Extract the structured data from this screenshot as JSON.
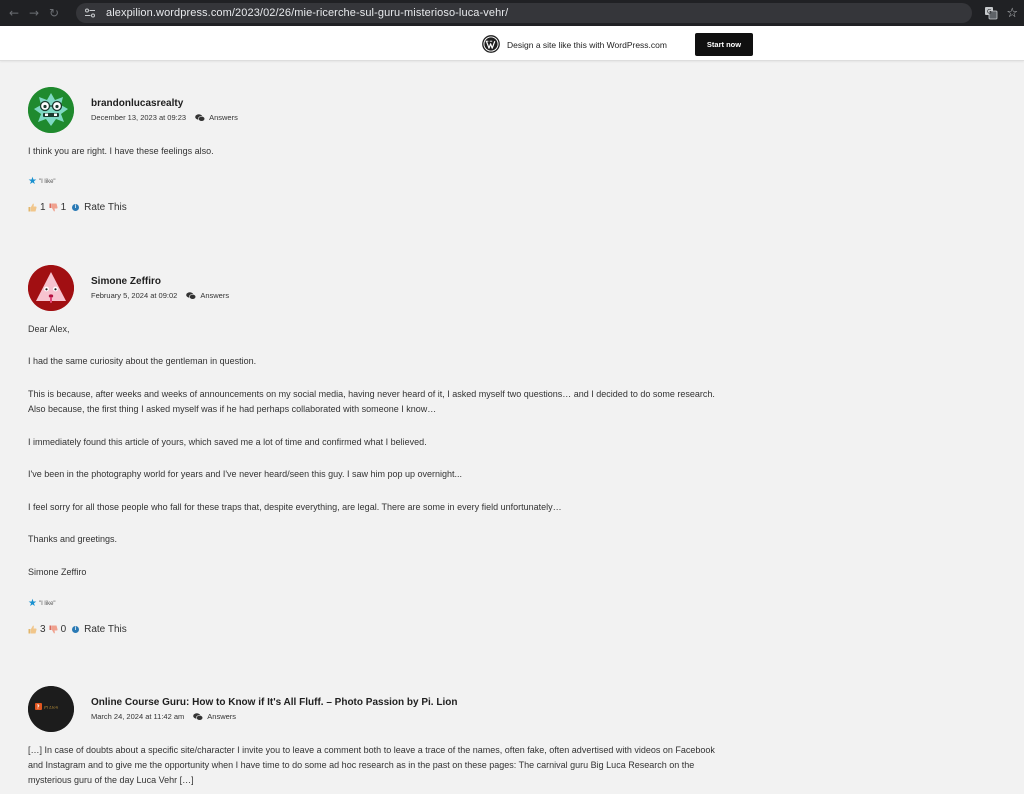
{
  "browser": {
    "url": "alexpilion.wordpress.com/2023/02/26/mie-ricerche-sul-guru-misterioso-luca-vehr/",
    "back_icon": "←",
    "forward_icon": "→",
    "reload_icon": "↻",
    "star_icon": "☆"
  },
  "wp_banner": {
    "text": "Design a site like this with WordPress.com",
    "button_label": "Start now"
  },
  "comments": [
    {
      "author": "brandonlucasrealty",
      "date": "December 13, 2023 at 09:23",
      "reply_label": "Answers",
      "paragraphs": [
        "I think you are right. I have these feelings also."
      ],
      "like_label": "\"I like\"",
      "thumbs_up": "1",
      "thumbs_down": "1",
      "rate_label": "Rate This",
      "avatar_color": "#1f8a2e"
    },
    {
      "author": "Simone Zeffiro",
      "date": "February 5, 2024 at 09:02",
      "reply_label": "Answers",
      "paragraphs": [
        "Dear Alex,",
        "I had the same curiosity about the gentleman in question.",
        "This is because, after weeks and weeks of announcements on my social media, having never heard of it, I asked myself two questions… and I decided to do some research. Also because, the first thing I asked myself was if he had perhaps collaborated with someone I know…",
        "I immediately found this article of yours, which saved me a lot of time and confirmed what I believed.",
        "I've been in the photography world for years and I've never heard/seen this guy. I saw him pop up overnight...",
        "I feel sorry for all those people who fall for these traps that, despite everything, are legal. There are some in every field unfortunately…",
        "Thanks and greetings.",
        "Simone Zeffiro"
      ],
      "like_label": "\"I like\"",
      "thumbs_up": "3",
      "thumbs_down": "0",
      "rate_label": "Rate This",
      "avatar_color": "#a10f12"
    },
    {
      "author": "Online Course Guru: How to Know if It's All Fluff. – Photo Passion by Pi. Lion",
      "date": "March 24, 2024 at 11:42 am",
      "reply_label": "Answers",
      "paragraphs": [
        "[…] In case of doubts about a specific site/character I invite you to leave a comment both to leave a trace of the names, often fake, often advertised with videos on Facebook and Instagram and to give me the opportunity when I have time to do some ad hoc research as in the past on these pages: The carnival guru Big Luca Research on the mysterious guru of the day Luca Vehr […]"
      ],
      "avatar_color": "#1c1c1c"
    }
  ]
}
